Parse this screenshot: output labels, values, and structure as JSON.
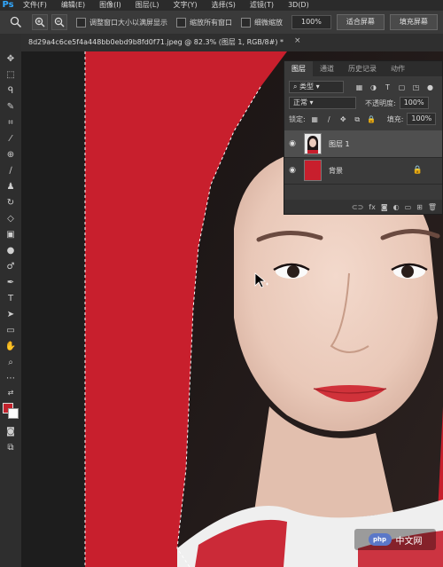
{
  "app": {
    "logo": "Ps"
  },
  "menu": [
    "文件(F)",
    "编辑(E)",
    "图像(I)",
    "图层(L)",
    "文字(Y)",
    "选择(S)",
    "滤镜(T)",
    "3D(D)"
  ],
  "options": {
    "zoom_in_icon": "zoom-in-icon",
    "zoom_out_icon": "zoom-out-icon",
    "resize_windows": "调整窗口大小以满屏显示",
    "zoom_all_windows": "缩放所有窗口",
    "scrubby_zoom": "细微缩放",
    "zoom_value": "100%",
    "fit_screen": "适合屏幕",
    "fill_screen": "填充屏幕"
  },
  "document": {
    "tab_title": "8d29a4c6ce5f4a448bb0ebd9b8fd0f71.jpeg @ 82.3% (图层 1, RGB/8#) *",
    "close": "×"
  },
  "colors": {
    "foreground": "#c2222c",
    "background": "#ffffff",
    "canvas_red": "#c81f2d"
  },
  "layers_panel": {
    "tabs": [
      "图层",
      "通道",
      "历史记录",
      "动作"
    ],
    "filter_kind": "类型",
    "blend_mode": "正常",
    "opacity_label": "不透明度:",
    "opacity_value": "100%",
    "lock_label": "锁定:",
    "fill_label": "填充:",
    "fill_value": "100%",
    "layers": [
      {
        "name": "图层 1",
        "selected": true,
        "locked": false
      },
      {
        "name": "背景",
        "selected": false,
        "locked": true
      }
    ],
    "footer_icons": [
      "link-icon",
      "fx-icon",
      "mask-icon",
      "adjustment-icon",
      "group-icon",
      "new-layer-icon",
      "trash-icon"
    ],
    "footer_fx": "fx"
  },
  "watermark": {
    "badge": "php",
    "text": "中文网"
  }
}
